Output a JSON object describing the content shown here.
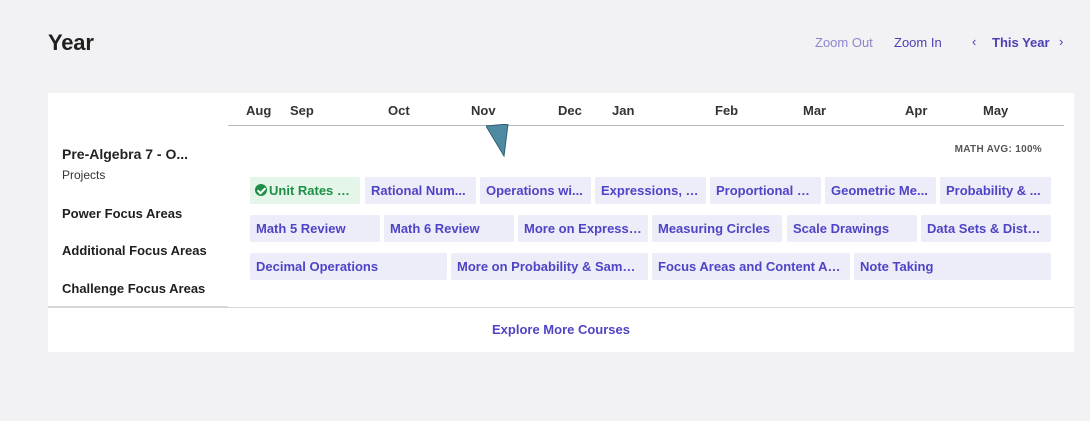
{
  "header": {
    "title": "Year",
    "zoom_out": "Zoom Out",
    "zoom_in": "Zoom In",
    "prev": "‹",
    "this_year": "This Year",
    "next": "›"
  },
  "timeline": {
    "months": [
      "Aug",
      "Sep",
      "Oct",
      "Nov",
      "Dec",
      "Jan",
      "Feb",
      "Mar",
      "Apr",
      "May"
    ]
  },
  "sidebar": {
    "course_title": "Pre-Algebra 7 - O...",
    "course_sub": "Projects",
    "rows": [
      "Power Focus Areas",
      "Additional Focus Areas",
      "Challenge Focus Areas"
    ]
  },
  "math_avg": "MATH AVG: 100%",
  "units": {
    "row1": [
      "Unit Rates &...",
      "Rational Num...",
      "Operations wi...",
      "Expressions, E...",
      "Proportional R...",
      "Geometric Me...",
      "Probability & ..."
    ],
    "row2": [
      "Math 5 Review",
      "Math 6 Review",
      "More on Expressi...",
      "Measuring Circles",
      "Scale Drawings",
      "Data Sets & Distri..."
    ],
    "row3": [
      "Decimal Operations",
      "More on Probability & Sampl...",
      "Focus Areas and Content As...",
      "Note Taking"
    ]
  },
  "explore": "Explore More Courses",
  "colors": {
    "accent": "#4f44c6",
    "pill_bg": "#edecf9",
    "done_bg": "#e4f6ea",
    "done_text": "#1f8f45",
    "pointer": "#4f8aa3"
  }
}
